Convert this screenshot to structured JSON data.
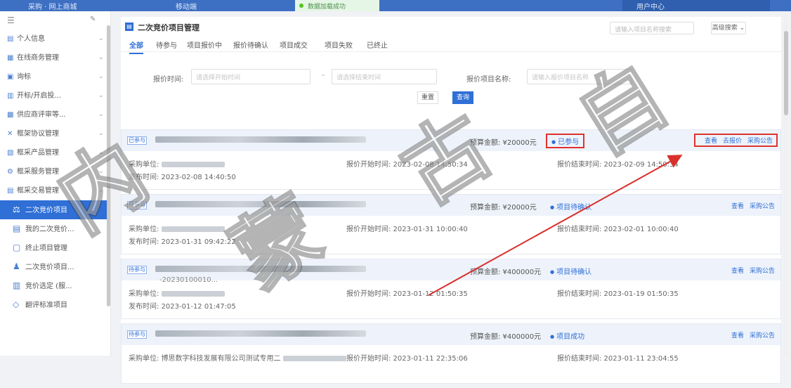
{
  "topbar": {
    "t1": "采购 · 网上商城",
    "t2": "移动端",
    "toast": "数据加载成功",
    "t3": "用户中心"
  },
  "sidebar": {
    "items": [
      {
        "icon": "▤",
        "label": "个人信息"
      },
      {
        "icon": "▦",
        "label": "在线商务管理"
      },
      {
        "icon": "▣",
        "label": "询标"
      },
      {
        "icon": "▥",
        "label": "开标/开启投..."
      },
      {
        "icon": "▩",
        "label": "供应商评审等..."
      },
      {
        "icon": "✕",
        "label": "框架协议管理"
      },
      {
        "icon": "▧",
        "label": "框采产品管理"
      },
      {
        "icon": "⚙",
        "label": "框采服务管理"
      },
      {
        "icon": "▤",
        "label": "框采交易管理"
      }
    ],
    "subitems": [
      {
        "icon": "⚖",
        "label": "二次竞价项目",
        "active": true
      },
      {
        "icon": "▤",
        "label": "我的二次竞价...",
        "active": false
      },
      {
        "icon": "▢",
        "label": "终止项目管理",
        "active": false
      },
      {
        "icon": "♟",
        "label": "二次竞价项目...",
        "active": false
      },
      {
        "icon": "▥",
        "label": "竞价选定 (服...",
        "active": false
      },
      {
        "icon": "◇",
        "label": "翻评标准项目",
        "active": false
      }
    ]
  },
  "header": {
    "title": "二次竞价项目管理",
    "search_placeholder": "请输入项目名称搜索",
    "adv_button": "高级搜索 ⌄"
  },
  "tabs": [
    "全部",
    "待参与",
    "项目报价中",
    "报价待确认",
    "项目成交",
    "项目失败",
    "已终止"
  ],
  "filters": {
    "time_label": "报价时间:",
    "start_placeholder": "请选择开始时间",
    "end_placeholder": "请选择结束时间",
    "name_label": "报价项目名称:",
    "name_placeholder": "请输入报价项目名称",
    "reset": "重置",
    "query": "查询"
  },
  "cards": [
    {
      "tag": "已参与",
      "code": "",
      "budget": "预算金额: ¥20000元",
      "status": "已参与",
      "ops": [
        "查看",
        "去报价",
        "采购公告"
      ],
      "highlight": true,
      "buyer": "采购单位:",
      "start": "报价开始时间: 2023-02-08 14:50:34",
      "end": "报价结束时间: 2023-02-09 14:50:34",
      "pub": "发布时间: 2023-02-08 14:40:50"
    },
    {
      "tag": "待参与",
      "code": "",
      "budget": "预算金额: ¥20000元",
      "status": "项目待确认",
      "ops": [
        "查看",
        "采购公告"
      ],
      "highlight": false,
      "buyer": "采购单位:",
      "start": "报价开始时间: 2023-01-31 10:00:40",
      "end": "报价结束时间: 2023-02-01 10:00:40",
      "pub": "发布时间: 2023-01-31 09:42:22"
    },
    {
      "tag": "待参与",
      "code": "-20230100010...",
      "budget": "预算金额: ¥400000元",
      "status": "项目待确认",
      "ops": [
        "查看",
        "采购公告"
      ],
      "highlight": false,
      "buyer": "采购单位:",
      "start": "报价开始时间: 2023-01-12 01:50:35",
      "end": "报价结束时间: 2023-01-19 01:50:35",
      "pub": "发布时间: 2023-01-12 01:47:05"
    },
    {
      "tag": "待参与",
      "code": "",
      "budget": "预算金额: ¥400000元",
      "status": "项目成功",
      "ops": [
        "查看",
        "采购公告"
      ],
      "highlight": false,
      "buyer": "采购单位: 博思数字科技发展有限公司测试专用二",
      "start": "报价开始时间: 2023-01-11 22:35:06",
      "end": "报价结束时间: 2023-01-11 23:04:55",
      "pub": ""
    }
  ],
  "watermark": [
    "内",
    "蒙",
    "古",
    "自"
  ]
}
